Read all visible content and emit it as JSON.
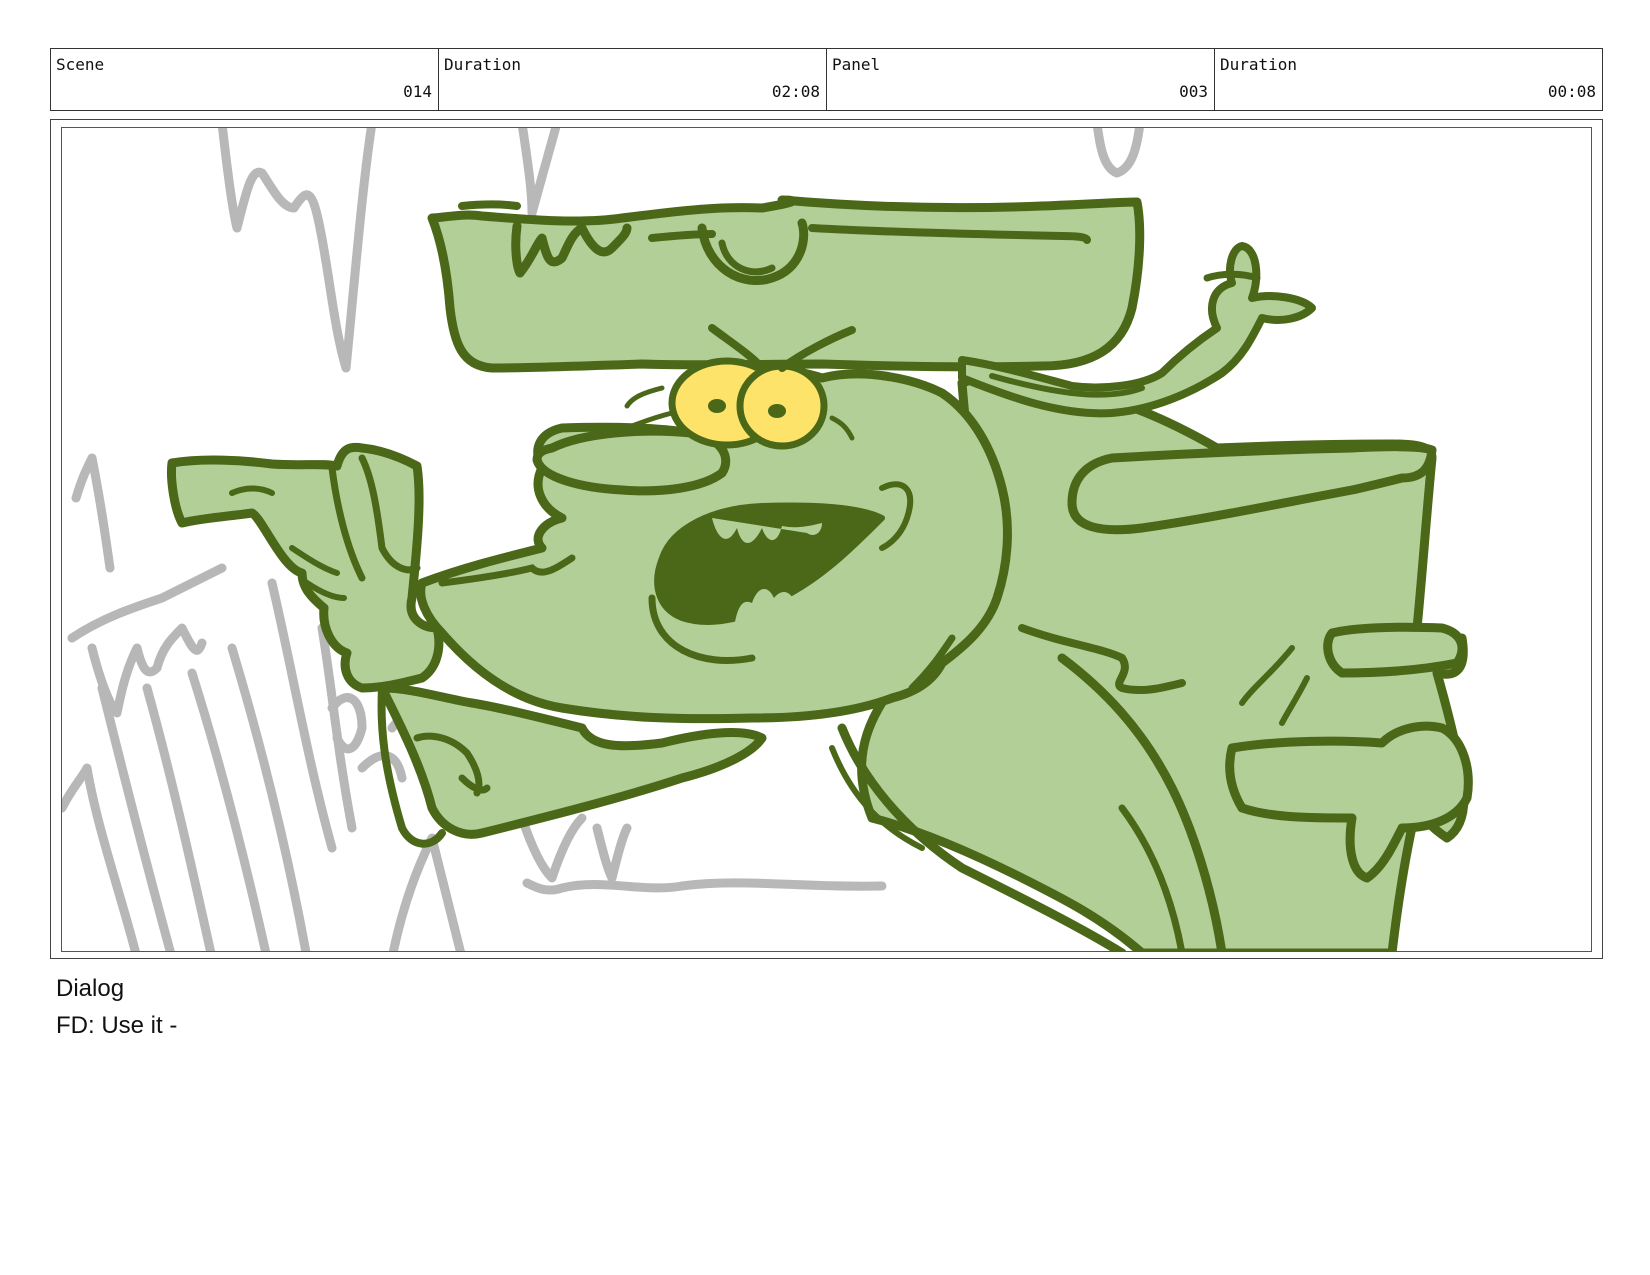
{
  "header": {
    "cells": [
      {
        "label": "Scene",
        "value": "014"
      },
      {
        "label": "Duration",
        "value": "02:08"
      },
      {
        "label": "Panel",
        "value": "003"
      },
      {
        "label": "Duration",
        "value": "00:08"
      }
    ]
  },
  "panel": {
    "fill_color": "#b3cf98",
    "line_color": "#4a6818",
    "eye_color": "#fde36a",
    "sketch_color": "#b4b4b4"
  },
  "dialog": {
    "label": "Dialog",
    "text": "FD: Use it -"
  }
}
